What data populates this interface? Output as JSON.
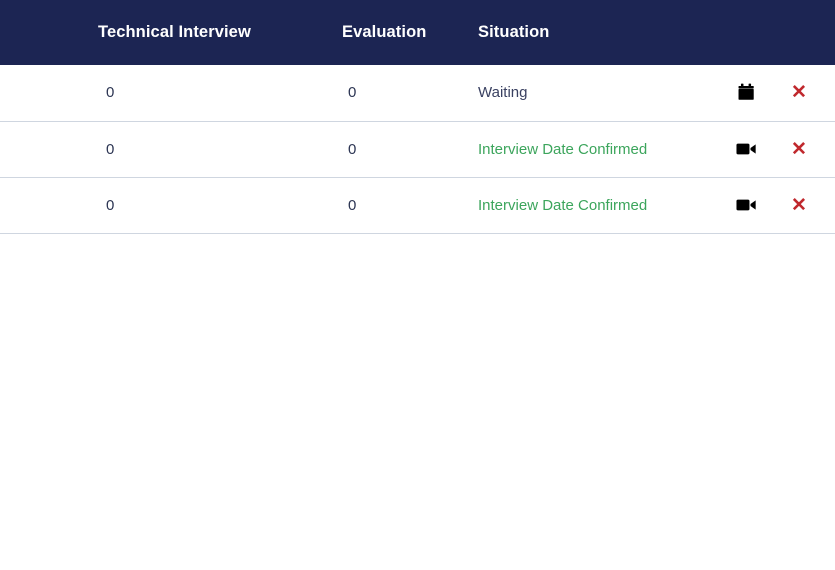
{
  "table": {
    "columns": [
      {
        "key": "technical_interview",
        "label": "Technical Interview"
      },
      {
        "key": "evaluation",
        "label": "Evaluation"
      },
      {
        "key": "situation",
        "label": "Situation"
      }
    ],
    "rows": [
      {
        "technical_interview": "0",
        "evaluation": "0",
        "situation": "Waiting",
        "situation_state": "waiting",
        "action_icon": "calendar-icon",
        "close_icon": "close-icon",
        "close_glyph": "✕"
      },
      {
        "technical_interview": "0",
        "evaluation": "0",
        "situation": "Interview Date Confirmed",
        "situation_state": "confirmed",
        "action_icon": "video-camera-icon",
        "close_icon": "close-icon",
        "close_glyph": "✕"
      },
      {
        "technical_interview": "0",
        "evaluation": "0",
        "situation": "Interview Date Confirmed",
        "situation_state": "confirmed",
        "action_icon": "video-camera-icon",
        "close_icon": "close-icon",
        "close_glyph": "✕"
      }
    ]
  },
  "colors": {
    "header_background": "#1c2553",
    "header_text": "#ffffff",
    "row_background": "#ffffff",
    "row_divider": "#cfd6e0",
    "text_default": "#2c3553",
    "status_waiting": "#3a4161",
    "status_confirmed": "#3ca55c",
    "close_icon": "#c0282d",
    "action_icon": "#000000"
  }
}
